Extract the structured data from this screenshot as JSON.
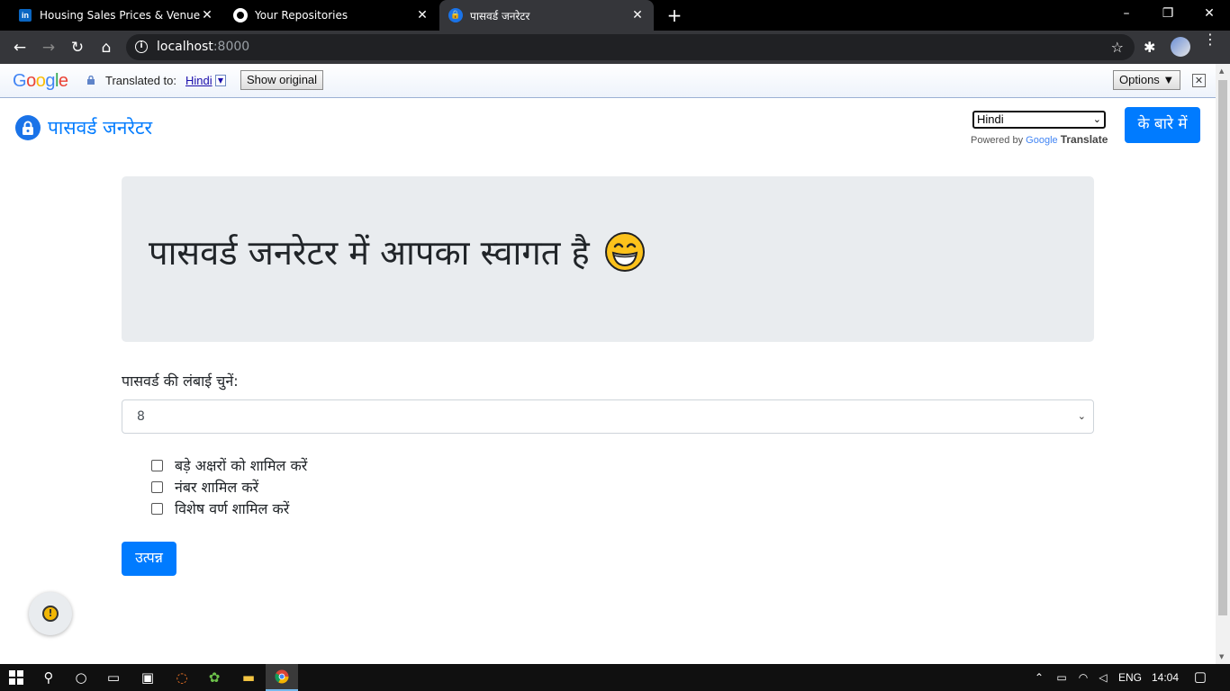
{
  "browser": {
    "tabs": [
      {
        "title": "Housing Sales Prices & Venues D",
        "icon": "linkedin-icon",
        "active": false
      },
      {
        "title": "Your Repositories",
        "icon": "github-icon",
        "active": false
      },
      {
        "title": "पासवर्ड जनरेटर",
        "icon": "lock-icon",
        "active": true
      }
    ],
    "url_host": "localhost",
    "url_port": ":8000"
  },
  "translate_bar": {
    "logo": "Google",
    "label": "Translated to:",
    "language": "Hindi",
    "show_original": "Show original",
    "options": "Options ▼"
  },
  "app": {
    "brand": "पासवर्ड जनरेटर",
    "language_select": "Hindi",
    "powered_by": "Powered by",
    "powered_google": "Google",
    "powered_translate": "Translate",
    "about_button": "के बारे में",
    "welcome_heading": "पासवर्ड जनरेटर में आपका स्वागत है",
    "length_label": "पासवर्ड की लंबाई चुनें:",
    "length_value": "8",
    "options": [
      {
        "label": "बड़े अक्षरों को शामिल करें",
        "checked": false
      },
      {
        "label": "नंबर शामिल करें",
        "checked": false
      },
      {
        "label": "विशेष वर्ण शामिल करें",
        "checked": false
      }
    ],
    "generate_button": "उत्पन्न"
  },
  "taskbar": {
    "language": "ENG",
    "time": "14:04"
  },
  "colors": {
    "primary": "#007bff",
    "jumbotron": "#e9ecef",
    "tab_bg": "#000000",
    "toolbar_bg": "#35363a"
  }
}
